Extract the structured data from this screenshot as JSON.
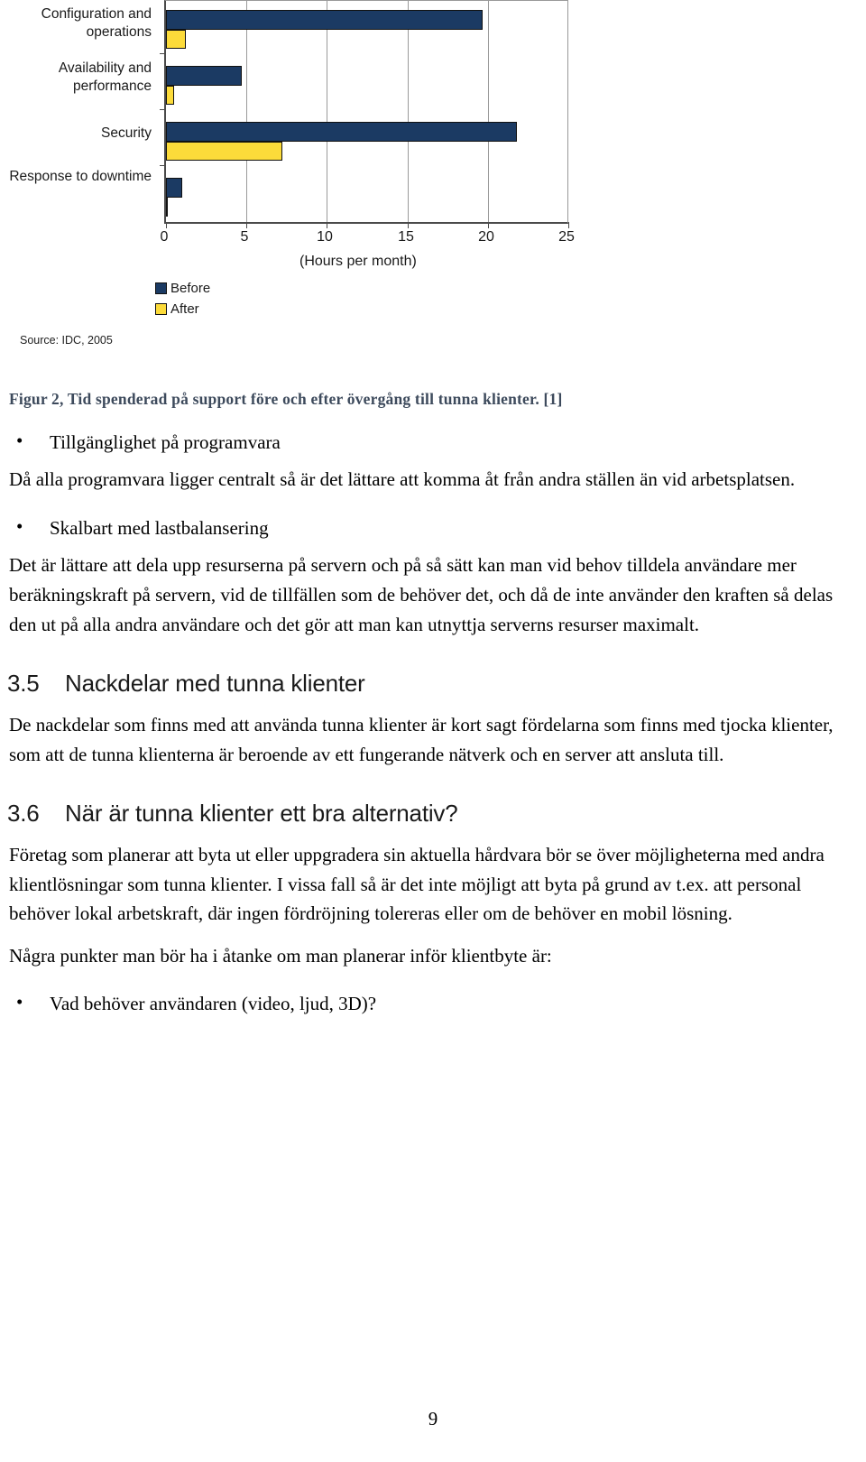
{
  "chart_data": {
    "type": "bar",
    "orientation": "horizontal",
    "title": "",
    "categories": [
      "Configuration and operations",
      "Availability and performance",
      "Security",
      "Response to downtime"
    ],
    "series": [
      {
        "name": "Before",
        "color": "#1b3a63",
        "values": [
          19.6,
          4.7,
          21.7,
          1.0
        ]
      },
      {
        "name": "After",
        "color": "#fcdb3a",
        "values": [
          1.2,
          0.5,
          7.2,
          0.05
        ]
      }
    ],
    "xlabel": "(Hours per month)",
    "ylabel": "",
    "xlim": [
      0,
      25
    ],
    "xticks": [
      "0",
      "5",
      "10",
      "15",
      "20",
      "25"
    ],
    "grid": true,
    "legend_position": "bottom-left",
    "source_note": "Source: IDC, 2005"
  },
  "figure": {
    "caption": "Figur 2, Tid spenderad på support före och efter övergång till tunna klienter. [1]",
    "caption_color": "#3d4a5c"
  },
  "document": {
    "bullets_top": [
      {
        "heading": "Tillgänglighet på programvara",
        "body": "Då alla programvara ligger centralt så är det lättare att komma åt från andra ställen än vid arbetsplatsen."
      },
      {
        "heading": "Skalbart med lastbalansering",
        "body": "Det är lättare att dela upp resurserna på servern och på så sätt kan man vid behov tilldela användare mer beräkningskraft på servern, vid de tillfällen som de behöver det, och då de inte använder den kraften så delas den ut på alla andra användare och det gör att man kan utnyttja serverns resurser maximalt."
      }
    ],
    "sections": [
      {
        "number": "3.5",
        "title": "Nackdelar med tunna klienter",
        "body": "De nackdelar som finns med att använda tunna klienter är kort sagt fördelarna som finns med tjocka klienter, som att de tunna klienterna är beroende av ett fungerande nätverk och en server att ansluta till."
      },
      {
        "number": "3.6",
        "title": "När är tunna klienter ett bra alternativ?",
        "body_1": "Företag som planerar att byta ut eller uppgradera sin aktuella hårdvara bör se över möjligheterna med andra klientlösningar som tunna klienter. I vissa fall så är det inte möjligt att byta på grund av t.ex. att personal behöver lokal arbetskraft, där ingen fördröjning tolereras eller om de behöver en mobil lösning.",
        "body_2": "Några punkter man bör ha i åtanke om man planerar inför klientbyte är:",
        "bullets": [
          "Vad behöver användaren (video, ljud, 3D)?"
        ]
      }
    ],
    "page_number": "9"
  }
}
